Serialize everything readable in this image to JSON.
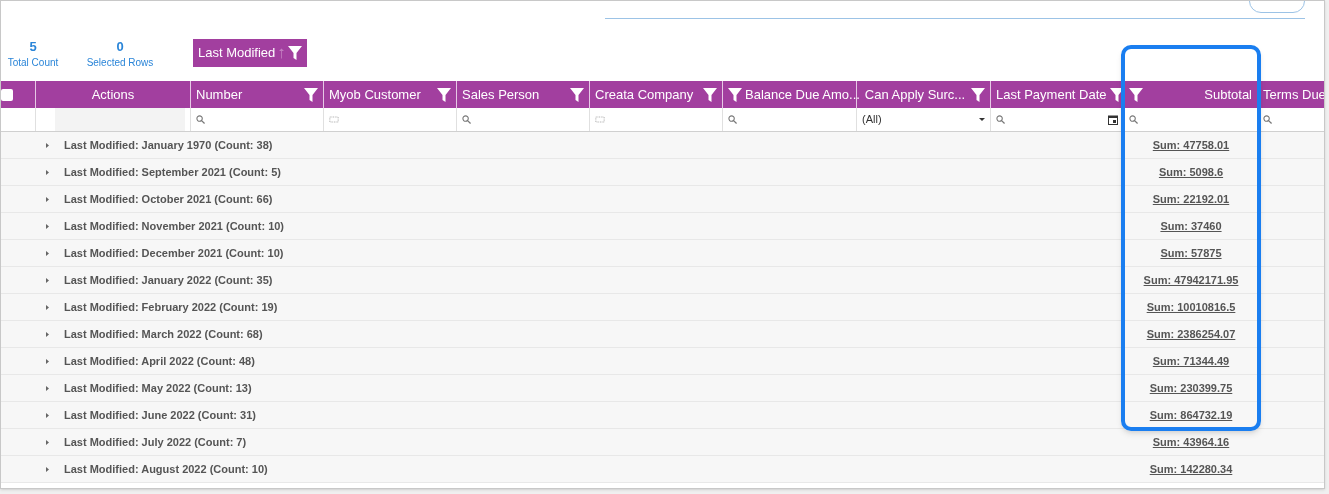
{
  "summary": [
    {
      "value": "5",
      "label": "Total Count"
    },
    {
      "value": "0",
      "label": "Selected Rows"
    }
  ],
  "group_chip": {
    "label": "Last Modified",
    "sort_ascending": true
  },
  "columns": [
    {
      "kind": "checkbox",
      "checked": false,
      "filter": {
        "kind": "none"
      }
    },
    {
      "kind": "header",
      "label": "Actions",
      "filter": {
        "kind": "none"
      }
    },
    {
      "kind": "header",
      "label": "Number",
      "filter": {
        "kind": "search"
      }
    },
    {
      "kind": "header",
      "label": "Myob Customer",
      "filter": {
        "kind": "text"
      }
    },
    {
      "kind": "header",
      "label": "Sales Person",
      "filter": {
        "kind": "search"
      }
    },
    {
      "kind": "header",
      "label": "Creata Company",
      "filter": {
        "kind": "text"
      }
    },
    {
      "kind": "header",
      "label": "Balance Due Amo...",
      "filter": {
        "kind": "search"
      }
    },
    {
      "kind": "header",
      "label": "Can Apply Surc...",
      "filter": {
        "kind": "select",
        "value": "(All)"
      }
    },
    {
      "kind": "header",
      "label": "Last Payment Date",
      "filter": {
        "kind": "date"
      }
    },
    {
      "kind": "header",
      "label": "Subtotal",
      "filter": {
        "kind": "search"
      }
    },
    {
      "kind": "header",
      "label": "Terms Due",
      "filter": {
        "kind": "search"
      }
    }
  ],
  "groups": [
    {
      "label": "Last Modified: January 1970 (Count: 38)",
      "sum": "Sum: 47758.01"
    },
    {
      "label": "Last Modified: September 2021 (Count: 5)",
      "sum": "Sum: 5098.6"
    },
    {
      "label": "Last Modified: October 2021 (Count: 66)",
      "sum": "Sum: 22192.01"
    },
    {
      "label": "Last Modified: November 2021 (Count: 10)",
      "sum": "Sum: 37460"
    },
    {
      "label": "Last Modified: December 2021 (Count: 10)",
      "sum": "Sum: 57875"
    },
    {
      "label": "Last Modified: January 2022 (Count: 35)",
      "sum": "Sum: 47942171.95"
    },
    {
      "label": "Last Modified: February 2022 (Count: 19)",
      "sum": "Sum: 10010816.5"
    },
    {
      "label": "Last Modified: March 2022 (Count: 68)",
      "sum": "Sum: 2386254.07"
    },
    {
      "label": "Last Modified: April 2022 (Count: 48)",
      "sum": "Sum: 71344.49"
    },
    {
      "label": "Last Modified: May 2022 (Count: 13)",
      "sum": "Sum: 230399.75"
    },
    {
      "label": "Last Modified: June 2022 (Count: 31)",
      "sum": "Sum: 864732.19"
    },
    {
      "label": "Last Modified: July 2022 (Count: 7)",
      "sum": "Sum: 43964.16"
    },
    {
      "label": "Last Modified: August 2022 (Count: 10)",
      "sum": "Sum: 142280.34"
    }
  ]
}
